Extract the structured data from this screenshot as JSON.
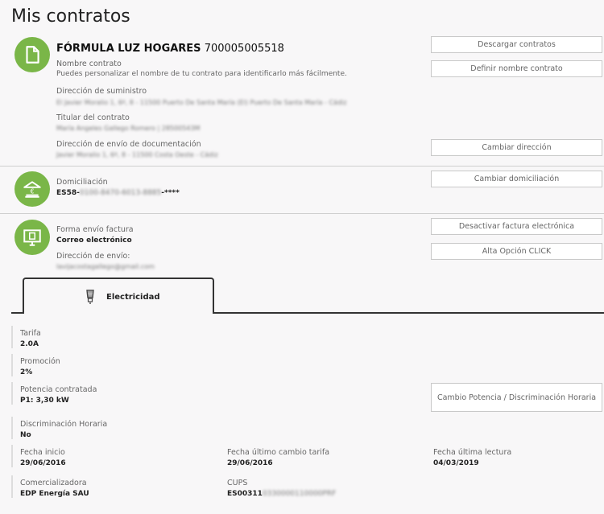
{
  "page": {
    "title": "Mis contratos"
  },
  "contract": {
    "product": "FÓRMULA LUZ HOGARES",
    "number": "700005005518",
    "name_label": "Nombre contrato",
    "name_hint": "Puedes personalizar el nombre de tu contrato para identificarlo más fácilmente.",
    "supply_label": "Dirección de suministro",
    "supply_value": "El Javier Moralio 1, 6º, 8 - 11500 Puerto De Santa María (El) Puerto De Santa María - Cádiz",
    "holder_label": "Titular del contrato",
    "holder_value": "María Angeles Gallego Romero | 28500543M",
    "docs_label": "Dirección de envío de documentación",
    "docs_value": "Javier Moralio 1, 6º, 8 - 11500 Costa Oeste - Cádiz",
    "buttons": {
      "download": "Descargar contratos",
      "define_name": "Definir nombre contrato",
      "change_address": "Cambiar dirección"
    }
  },
  "billing": {
    "label": "Domiciliación",
    "iban_visible": "ES58-",
    "iban_hidden": "0100-8470-6013-8885",
    "iban_mask": "-****",
    "button": "Cambiar domiciliación"
  },
  "invoice": {
    "label": "Forma envío factura",
    "value": "Correo electrónico",
    "address_label": "Dirección de envío:",
    "address_value": "lavijacostagallego@gmail.com",
    "buttons": {
      "deactivate": "Desactivar factura electrónica",
      "click": "Alta Opción CLICK"
    }
  },
  "tabs": {
    "electricity": "Electricidad"
  },
  "electricity": {
    "tariff_label": "Tarifa",
    "tariff_value": "2.0A",
    "promo_label": "Promoción",
    "promo_value": "2%",
    "power_label": "Potencia contratada",
    "power_value": "P1: 3,30 kW",
    "power_button": "Cambio Potencia / Discriminación Horaria",
    "dh_label": "Discriminación Horaria",
    "dh_value": "No",
    "start_label": "Fecha inicio",
    "start_value": "29/06/2016",
    "last_change_label": "Fecha último cambio tarifa",
    "last_change_value": "29/06/2016",
    "last_reading_label": "Fecha última lectura",
    "last_reading_value": "04/03/2019",
    "retailer_label": "Comercializadora",
    "retailer_value": "EDP Energía SAU",
    "cups_label": "CUPS",
    "cups_visible": "ES00311",
    "cups_hidden": "0330000110000PRF"
  },
  "colors": {
    "accent": "#7ab648"
  }
}
